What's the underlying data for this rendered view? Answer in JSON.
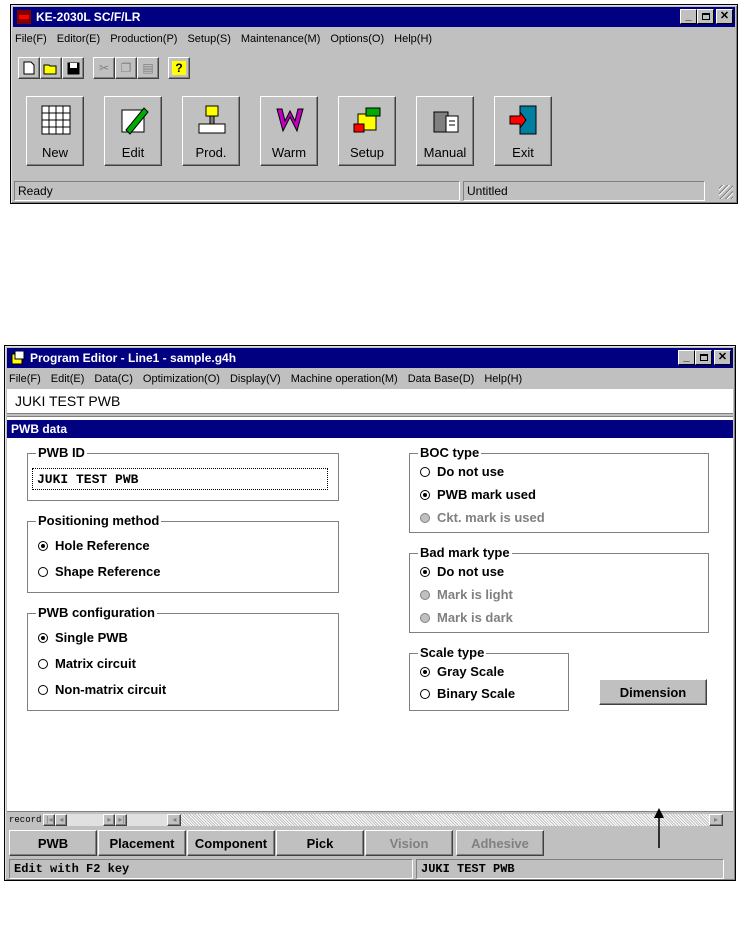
{
  "main_window": {
    "title": "KE-2030L SC/F/LR",
    "menu": [
      "File(F)",
      "Editor(E)",
      "Production(P)",
      "Setup(S)",
      "Maintenance(M)",
      "Options(O)",
      "Help(H)"
    ],
    "toolbar_icons": [
      "new-file-icon",
      "open-folder-icon",
      "save-icon",
      "cut-icon",
      "copy-icon",
      "paste-icon",
      "help-icon"
    ],
    "big_buttons": [
      {
        "label": "New",
        "icon": "grid-icon"
      },
      {
        "label": "Edit",
        "icon": "edit-pen-icon"
      },
      {
        "label": "Prod.",
        "icon": "production-icon"
      },
      {
        "label": "Warm",
        "icon": "warm-icon"
      },
      {
        "label": "Setup",
        "icon": "setup-icon"
      },
      {
        "label": "Manual",
        "icon": "manual-icon"
      },
      {
        "label": "Exit",
        "icon": "exit-door-icon"
      }
    ],
    "status_left": "Ready",
    "status_right": "Untitled"
  },
  "editor_window": {
    "title": "Program Editor - Line1 - sample.g4h",
    "menu": [
      "File(F)",
      "Edit(E)",
      "Data(C)",
      "Optimization(O)",
      "Display(V)",
      "Machine operation(M)",
      "Data Base(D)",
      "Help(H)"
    ],
    "subtitle": "JUKI TEST PWB",
    "section_title": "PWB data",
    "pwb_id": {
      "label": "PWB ID",
      "value": "JUKI TEST PWB"
    },
    "positioning": {
      "label": "Positioning method",
      "options": [
        "Hole Reference",
        "Shape Reference"
      ],
      "selected": 0
    },
    "configuration": {
      "label": "PWB configuration",
      "options": [
        "Single PWB",
        "Matrix circuit",
        "Non-matrix circuit"
      ],
      "selected": 0
    },
    "boc": {
      "label": "BOC type",
      "options": [
        "Do not use",
        "PWB mark used",
        "Ckt. mark is used"
      ],
      "selected": 1
    },
    "bad_mark": {
      "label": "Bad mark type",
      "options": [
        "Do not use",
        "Mark is light",
        "Mark is dark"
      ],
      "selected": 0
    },
    "scale": {
      "label": "Scale type",
      "options": [
        "Gray Scale",
        "Binary Scale"
      ],
      "selected": 0
    },
    "dimension_button": "Dimension",
    "record_label": "record",
    "tabs": [
      "PWB",
      "Placement",
      "Component",
      "Pick",
      "Vision",
      "Adhesive"
    ],
    "status_left": "Edit with F2 key",
    "status_right": "JUKI TEST PWB"
  },
  "colors": {
    "face": "#c0c0c0",
    "title": "#000080",
    "disabled": "#808080"
  }
}
